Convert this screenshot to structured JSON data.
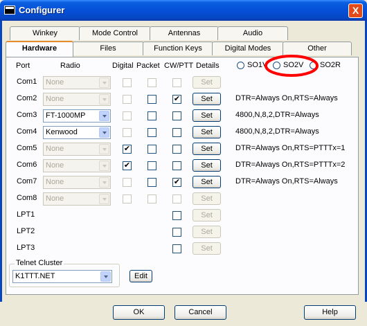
{
  "window": {
    "title": "Configurer",
    "close": "X"
  },
  "tabs_back": [
    "Winkey",
    "Mode Control",
    "Antennas",
    "Audio"
  ],
  "tabs_front": [
    "Hardware",
    "Files",
    "Function Keys",
    "Digital Modes",
    "Other"
  ],
  "active_tab": "Hardware",
  "headers": {
    "port": "Port",
    "radio": "Radio",
    "digital": "Digital",
    "packet": "Packet",
    "cwptt": "CW/PTT",
    "details": "Details"
  },
  "so_modes": [
    {
      "label": "SO1V",
      "selected": false
    },
    {
      "label": "SO2V",
      "selected": false,
      "highlighted": true,
      "highlight_color": "#ff0000"
    },
    {
      "label": "SO2R",
      "selected": false
    }
  ],
  "rows": [
    {
      "port": "Com1",
      "radio": "None",
      "radio_enabled": false,
      "digital": false,
      "digital_enabled": false,
      "packet": false,
      "packet_enabled": false,
      "cwptt": false,
      "cwptt_enabled": false,
      "set": "Set",
      "set_enabled": false,
      "detail": ""
    },
    {
      "port": "Com2",
      "radio": "None",
      "radio_enabled": false,
      "digital": false,
      "digital_enabled": false,
      "packet": false,
      "packet_enabled": true,
      "cwptt": true,
      "cwptt_enabled": true,
      "set": "Set",
      "set_enabled": true,
      "detail": "DTR=Always On,RTS=Always"
    },
    {
      "port": "Com3",
      "radio": "FT-1000MP",
      "radio_enabled": true,
      "digital": false,
      "digital_enabled": false,
      "packet": false,
      "packet_enabled": true,
      "cwptt": false,
      "cwptt_enabled": true,
      "set": "Set",
      "set_enabled": true,
      "detail": "4800,N,8,2,DTR=Always"
    },
    {
      "port": "Com4",
      "radio": "Kenwood",
      "radio_enabled": true,
      "digital": false,
      "digital_enabled": false,
      "packet": false,
      "packet_enabled": true,
      "cwptt": false,
      "cwptt_enabled": true,
      "set": "Set",
      "set_enabled": true,
      "detail": "4800,N,8,2,DTR=Always"
    },
    {
      "port": "Com5",
      "radio": "None",
      "radio_enabled": false,
      "digital": true,
      "digital_enabled": true,
      "packet": false,
      "packet_enabled": true,
      "cwptt": false,
      "cwptt_enabled": true,
      "set": "Set",
      "set_enabled": true,
      "detail": "DTR=Always On,RTS=PTTTx=1"
    },
    {
      "port": "Com6",
      "radio": "None",
      "radio_enabled": false,
      "digital": true,
      "digital_enabled": true,
      "packet": false,
      "packet_enabled": true,
      "cwptt": false,
      "cwptt_enabled": true,
      "set": "Set",
      "set_enabled": true,
      "detail": "DTR=Always On,RTS=PTTTx=2"
    },
    {
      "port": "Com7",
      "radio": "None",
      "radio_enabled": false,
      "digital": false,
      "digital_enabled": false,
      "packet": false,
      "packet_enabled": true,
      "cwptt": true,
      "cwptt_enabled": true,
      "set": "Set",
      "set_enabled": true,
      "detail": "DTR=Always On,RTS=Always"
    },
    {
      "port": "Com8",
      "radio": "None",
      "radio_enabled": false,
      "digital": false,
      "digital_enabled": false,
      "packet": false,
      "packet_enabled": false,
      "cwptt": false,
      "cwptt_enabled": false,
      "set": "Set",
      "set_enabled": false,
      "detail": ""
    },
    {
      "port": "LPT1",
      "cwptt": false,
      "cwptt_enabled": true,
      "set": "Set",
      "set_enabled": false
    },
    {
      "port": "LPT2",
      "cwptt": false,
      "cwptt_enabled": true,
      "set": "Set",
      "set_enabled": false
    },
    {
      "port": "LPT3",
      "cwptt": false,
      "cwptt_enabled": true,
      "set": "Set",
      "set_enabled": false
    }
  ],
  "telnet": {
    "label": "Telnet Cluster",
    "value": "K1TTT.NET",
    "edit": "Edit"
  },
  "buttons": {
    "ok": "OK",
    "cancel": "Cancel",
    "help": "Help"
  },
  "colors": {
    "titlebar": "#0550d8",
    "face": "#ece9d8",
    "close": "#e24a1a",
    "tab_accent": "#e68b2c"
  }
}
